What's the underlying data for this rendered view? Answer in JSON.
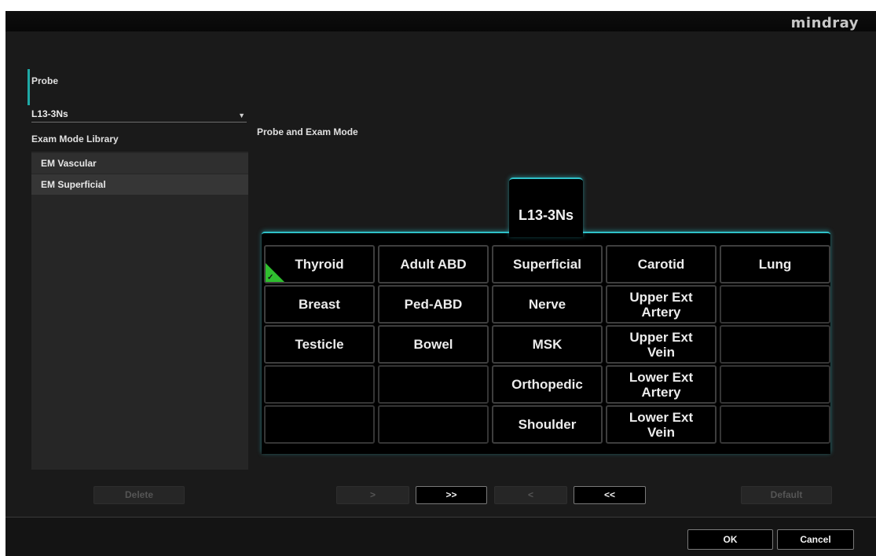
{
  "brand": "mindray",
  "probe": {
    "label": "Probe",
    "selected": "L13-3Ns",
    "arrow_icon": "triangle-down-icon"
  },
  "library": {
    "label": "Exam Mode Library",
    "items": [
      {
        "label": "EM Vascular"
      },
      {
        "label": "EM Superficial"
      }
    ]
  },
  "section": {
    "label": "Probe and Exam Mode"
  },
  "tab": {
    "label": "L13-3Ns"
  },
  "grid": {
    "checked_color": "#2fbf2f",
    "cells": [
      "Thyroid",
      "Adult ABD",
      "Superficial",
      "Carotid",
      "Lung",
      "Breast",
      "Ped-ABD",
      "Nerve",
      "Upper Ext\nArtery",
      "",
      "Testicle",
      "Bowel",
      "MSK",
      "Upper Ext\nVein",
      "",
      "",
      "",
      "Orthopedic",
      "Lower Ext\nArtery",
      "",
      "",
      "",
      "Shoulder",
      "Lower Ext\nVein",
      ""
    ],
    "checked_index": 0
  },
  "buttons": {
    "delete": "Delete",
    "move_one": ">",
    "move_all": ">>",
    "remove_one": "<",
    "remove_all": "<<",
    "default": "Default",
    "ok": "OK",
    "cancel": "Cancel"
  },
  "colors": {
    "accent": "#2fc1c8",
    "background": "#1a1a1a",
    "panel": "#000000"
  }
}
